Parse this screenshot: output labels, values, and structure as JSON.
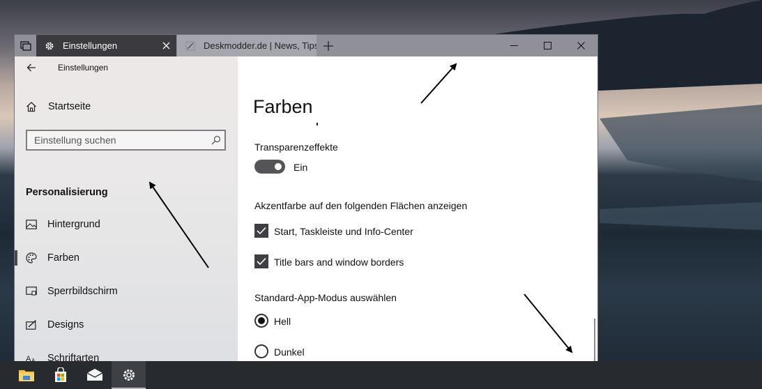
{
  "browser": {
    "tabs": [
      {
        "label": "Einstellungen",
        "active": true,
        "icon": "gear-icon"
      },
      {
        "label": "Deskmodder.de | News, Tips",
        "active": false,
        "icon": "pen-icon"
      }
    ],
    "new_tab_icon": "plus-icon",
    "controls": [
      "minimize-icon",
      "maximize-icon",
      "close-icon"
    ]
  },
  "sidebar": {
    "app_title": "Einstellungen",
    "home_label": "Startseite",
    "search_placeholder": "Einstellung suchen",
    "section_title": "Personalisierung",
    "items": [
      {
        "label": "Hintergrund",
        "icon": "picture-icon",
        "selected": false
      },
      {
        "label": "Farben",
        "icon": "palette-icon",
        "selected": true
      },
      {
        "label": "Sperrbildschirm",
        "icon": "lockscreen-icon",
        "selected": false
      },
      {
        "label": "Designs",
        "icon": "themes-icon",
        "selected": false
      },
      {
        "label": "Schriftarten",
        "icon": "fonts-icon",
        "selected": false
      }
    ]
  },
  "content": {
    "title": "Farben",
    "transparency": {
      "label": "Transparenzeffekte",
      "state_text": "Ein",
      "on": true
    },
    "accent": {
      "label": "Akzentfarbe auf den folgenden Flächen anzeigen",
      "options": [
        {
          "label": "Start, Taskleiste und Info-Center",
          "checked": true
        },
        {
          "label": "Title bars and window borders",
          "checked": true
        }
      ]
    },
    "app_mode": {
      "label": "Standard-App-Modus auswählen",
      "options": [
        {
          "label": "Hell",
          "selected": true
        },
        {
          "label": "Dunkel",
          "selected": false
        }
      ]
    }
  },
  "taskbar": {
    "apps": [
      "file-explorer-icon",
      "store-icon",
      "mail-icon",
      "settings-icon"
    ],
    "active_app": "settings-icon"
  },
  "colors": {
    "accent": "#3f3f43",
    "tab_active": "#3b3b3f",
    "taskbar": "#272a2e"
  }
}
